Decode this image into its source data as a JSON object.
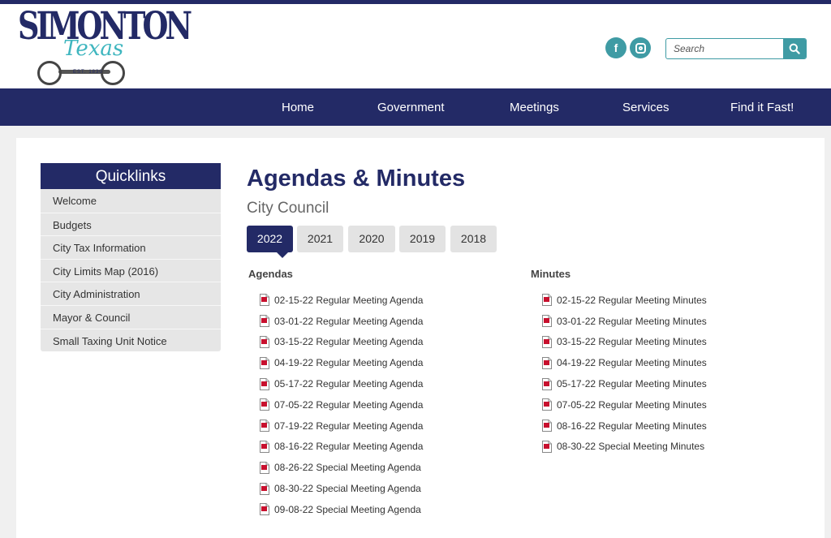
{
  "brand": {
    "name": "SIMONTON",
    "script": "Texas",
    "est": "EST. 1830"
  },
  "social": {
    "facebook_glyph": "f"
  },
  "search": {
    "placeholder": "Search"
  },
  "nav": {
    "items": [
      {
        "label": "Home"
      },
      {
        "label": "Government"
      },
      {
        "label": "Meetings"
      },
      {
        "label": "Services"
      },
      {
        "label": "Find it Fast!"
      }
    ]
  },
  "sidebar": {
    "title": "Quicklinks",
    "items": [
      {
        "label": "Welcome"
      },
      {
        "label": "Budgets"
      },
      {
        "label": "City Tax Information"
      },
      {
        "label": "City Limits Map (2016)"
      },
      {
        "label": "City Administration"
      },
      {
        "label": "Mayor & Council"
      },
      {
        "label": "Small Taxing Unit Notice"
      }
    ]
  },
  "main": {
    "title": "Agendas & Minutes",
    "subtitle": "City Council",
    "tabs": [
      {
        "label": "2022",
        "active": true
      },
      {
        "label": "2021"
      },
      {
        "label": "2020"
      },
      {
        "label": "2019"
      },
      {
        "label": "2018"
      }
    ],
    "agendas": {
      "heading": "Agendas",
      "items": [
        {
          "label": "02-15-22 Regular Meeting Agenda"
        },
        {
          "label": "03-01-22 Regular Meeting Agenda"
        },
        {
          "label": "03-15-22 Regular Meeting Agenda"
        },
        {
          "label": "04-19-22 Regular Meeting Agenda"
        },
        {
          "label": "05-17-22 Regular Meeting Agenda"
        },
        {
          "label": "07-05-22 Regular Meeting Agenda"
        },
        {
          "label": "07-19-22 Regular Meeting Agenda"
        },
        {
          "label": "08-16-22 Regular Meeting Agenda"
        },
        {
          "label": "08-26-22 Special Meeting Agenda"
        },
        {
          "label": "08-30-22 Special Meeting Agenda"
        },
        {
          "label": "09-08-22 Special Meeting Agenda"
        }
      ]
    },
    "minutes": {
      "heading": "Minutes",
      "items": [
        {
          "label": "02-15-22 Regular Meeting Minutes"
        },
        {
          "label": "03-01-22 Regular Meeting Minutes"
        },
        {
          "label": "03-15-22 Regular Meeting Minutes"
        },
        {
          "label": "04-19-22 Regular Meeting Minutes"
        },
        {
          "label": "05-17-22 Regular Meeting Minutes"
        },
        {
          "label": "07-05-22 Regular Meeting Minutes"
        },
        {
          "label": "08-16-22 Regular Meeting Minutes"
        },
        {
          "label": "08-30-22 Special Meeting Minutes"
        }
      ]
    }
  },
  "icons": {
    "search": "search-icon",
    "facebook": "facebook-icon",
    "instagram": "instagram-icon",
    "pdf": "pdf-file-icon"
  },
  "colors": {
    "brand_navy": "#232a66",
    "accent_teal": "#3f9ba4",
    "logo_teal": "#3fb6bf",
    "pdf_red": "#c8102e"
  }
}
